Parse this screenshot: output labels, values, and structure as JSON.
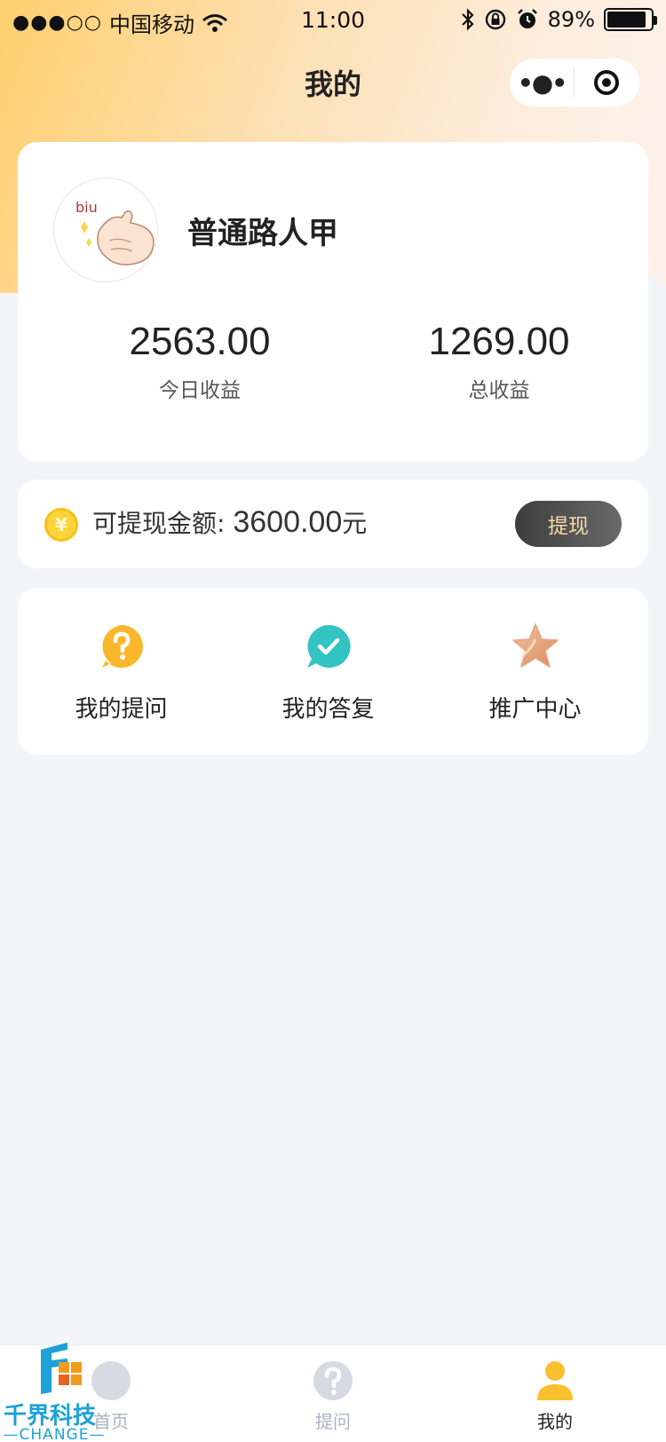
{
  "status_bar": {
    "signal": "●●●○○",
    "carrier": "中国移动",
    "time": "11:00",
    "battery_percent_text": "89%",
    "battery_level": 0.89
  },
  "nav": {
    "title": "我的",
    "more_glyph": "•●•"
  },
  "profile": {
    "username": "普通路人甲",
    "avatar_text": "biu",
    "stats": [
      {
        "value": "2563.00",
        "label": "今日收益"
      },
      {
        "value": "1269.00",
        "label": "总收益"
      }
    ]
  },
  "withdraw": {
    "coin_symbol": "¥",
    "label": "可提现金额: ",
    "amount": "3600.00",
    "unit": "元",
    "button_label": "提现"
  },
  "menu": [
    {
      "label": "我的提问",
      "icon": "question-icon",
      "color": "#fbb72c"
    },
    {
      "label": "我的答复",
      "icon": "check-bubble-icon",
      "color": "#33c3c3"
    },
    {
      "label": "推广中心",
      "icon": "star-icon",
      "color": "#e9a57c"
    }
  ],
  "tab_bar": [
    {
      "label": "首页",
      "icon": "home-icon",
      "active": false
    },
    {
      "label": "提问",
      "icon": "question-tab-icon",
      "active": false
    },
    {
      "label": "我的",
      "icon": "user-icon",
      "active": true
    }
  ],
  "watermark": {
    "title": "千界科技",
    "subtitle": "CHANGE"
  },
  "colors": {
    "accent": "#fbc02d",
    "tab_inactive": "#a9b3c4",
    "withdraw_button_text": "#f5d9a6"
  }
}
